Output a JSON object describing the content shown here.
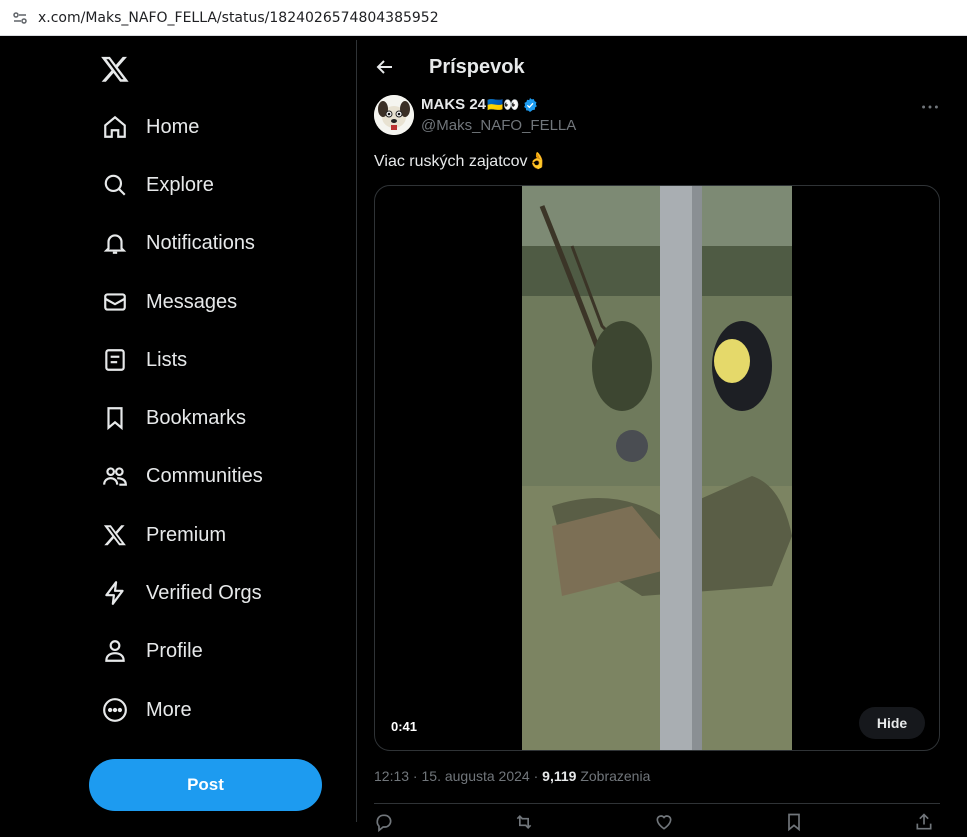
{
  "browser": {
    "url": "x.com/Maks_NAFO_FELLA/status/1824026574804385952"
  },
  "sidebar": {
    "logo": "x-logo-icon",
    "items": [
      {
        "label": "Home",
        "icon": "home-icon"
      },
      {
        "label": "Explore",
        "icon": "search-icon"
      },
      {
        "label": "Notifications",
        "icon": "bell-icon"
      },
      {
        "label": "Messages",
        "icon": "envelope-icon"
      },
      {
        "label": "Lists",
        "icon": "list-icon"
      },
      {
        "label": "Bookmarks",
        "icon": "bookmark-icon"
      },
      {
        "label": "Communities",
        "icon": "people-icon"
      },
      {
        "label": "Premium",
        "icon": "x-logo-icon"
      },
      {
        "label": "Verified Orgs",
        "icon": "lightning-icon"
      },
      {
        "label": "Profile",
        "icon": "person-icon"
      },
      {
        "label": "More",
        "icon": "more-circle-icon"
      }
    ],
    "post_label": "Post"
  },
  "header": {
    "title": "Príspevok"
  },
  "tweet": {
    "author_name": "MAKS 24",
    "author_emoji": "🇺🇦👀",
    "author_handle": "@Maks_NAFO_FELLA",
    "text": "Viac ruských zajatcov👌",
    "video_duration": "0:41",
    "hide_label": "Hide",
    "time": "12:13",
    "date": "15. augusta 2024",
    "views_count": "9,119",
    "views_label": "Zobrazenia"
  },
  "colors": {
    "accent": "#1d9bf0",
    "background": "#000000",
    "text": "#e7e9ea",
    "muted": "#71767b"
  }
}
